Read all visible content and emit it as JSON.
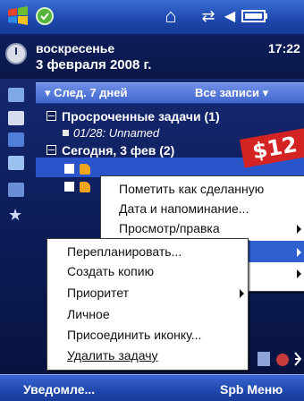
{
  "status_bar": {
    "icons": [
      "windows-start-icon",
      "round-app-icon",
      "home-icon",
      "sync-icon",
      "volume-icon",
      "battery-icon"
    ]
  },
  "today": {
    "weekday": "воскресенье",
    "date": "3 февраля 2008 г.",
    "time": "17:22"
  },
  "tasks_toolbar": {
    "filter": "▾ След. 7 дней",
    "view": "Все записи ▾"
  },
  "tasks": {
    "overdue_header": "Просроченные задачи (1)",
    "overdue_item": "01/28: Unnamed",
    "today_header": "Сегодня, 3 фев (2)"
  },
  "overlay": {
    "price": "$12"
  },
  "context_menu": {
    "items": [
      {
        "label": "Пометить как сделанную"
      },
      {
        "label": "Дата и напоминание..."
      },
      {
        "label": "Просмотр/правка"
      }
    ]
  },
  "submenu": {
    "items": [
      {
        "label": "Перепланировать..."
      },
      {
        "label": "Создать копию"
      },
      {
        "label": "Приоритет"
      },
      {
        "label": "Личное"
      },
      {
        "label": "Присоединить иконку..."
      },
      {
        "label": "Удалить задачу"
      }
    ]
  },
  "softkeys": {
    "left": "Уведомле...",
    "right": "Spb Меню"
  },
  "colors": {
    "accent": "#2f5fd0",
    "background": "#0c1d5a",
    "price_tag": "#d42323"
  }
}
